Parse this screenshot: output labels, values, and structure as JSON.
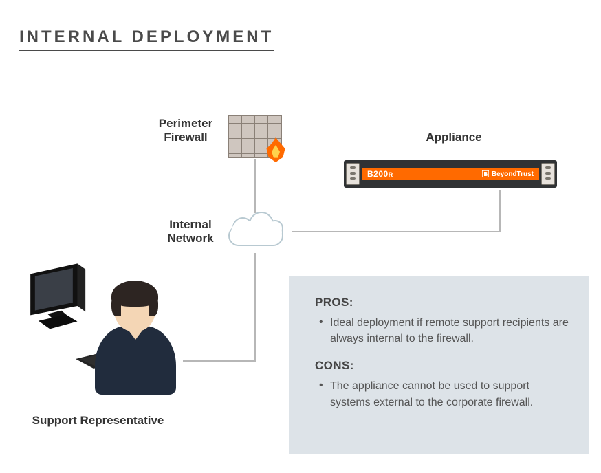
{
  "title": "INTERNAL  DEPLOYMENT",
  "labels": {
    "firewall": "Perimeter\nFirewall",
    "appliance": "Appliance",
    "network": "Internal\nNetwork",
    "rep": "Support Representative"
  },
  "appliance": {
    "model": "B200",
    "model_suffix": "R",
    "brand": "BeyondTrust"
  },
  "info": {
    "pros_head": "PROS:",
    "pros_items": [
      "Ideal deployment if remote support recipients are always internal to the firewall."
    ],
    "cons_head": "CONS:",
    "cons_items": [
      "The appliance cannot be used to support systems external to the corporate firewall."
    ]
  }
}
